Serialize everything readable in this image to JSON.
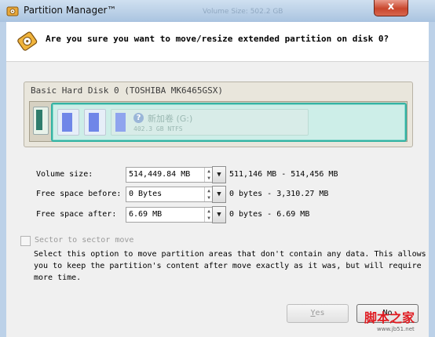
{
  "window": {
    "title": "Partition Manager™",
    "ghost_title": "Volume Size: 502.2 GB",
    "close_glyph": "x"
  },
  "dialog": {
    "question": "Are you sure you want to move/resize extended partition on disk 0?"
  },
  "disk_map": {
    "disk_label": "Basic Hard Disk 0 (TOSHIBA MK6465GSX)",
    "selected_partition_name": "新加卷 (G:)",
    "selected_partition_size": "402.3 GB NTFS",
    "unknown_glyph": "?"
  },
  "fields": [
    {
      "label": "Volume size:",
      "value": "514,449.84 MB",
      "range": "511,146 MB - 514,456 MB"
    },
    {
      "label": "Free space before:",
      "value": "0 Bytes",
      "range": "0 bytes - 3,310.27 MB"
    },
    {
      "label": "Free space after:",
      "value": "6.69 MB",
      "range": "0 bytes - 6.69 MB"
    }
  ],
  "spin_arrows": {
    "up": "▲",
    "down": "▼"
  },
  "dropdown_glyph": "▼",
  "sector_option": {
    "label": "Sector to sector move",
    "checked": false,
    "description": "Select this option to move partition areas that don't contain any data. This allows you to keep the partition's content after move exactly as it was, but will require more time."
  },
  "buttons": {
    "yes_mnemonic": "Y",
    "yes_rest": "es",
    "no": "No"
  },
  "watermark": {
    "text": "脚本之家",
    "url": "www.jb51.net"
  },
  "colors": {
    "extended_partition_border": "#33b3a3",
    "logical_partition_fill": "#6f86e8",
    "primary_partition_fill": "#2f7d6c",
    "close_button": "#c9462c",
    "watermark": "#e01a20"
  }
}
